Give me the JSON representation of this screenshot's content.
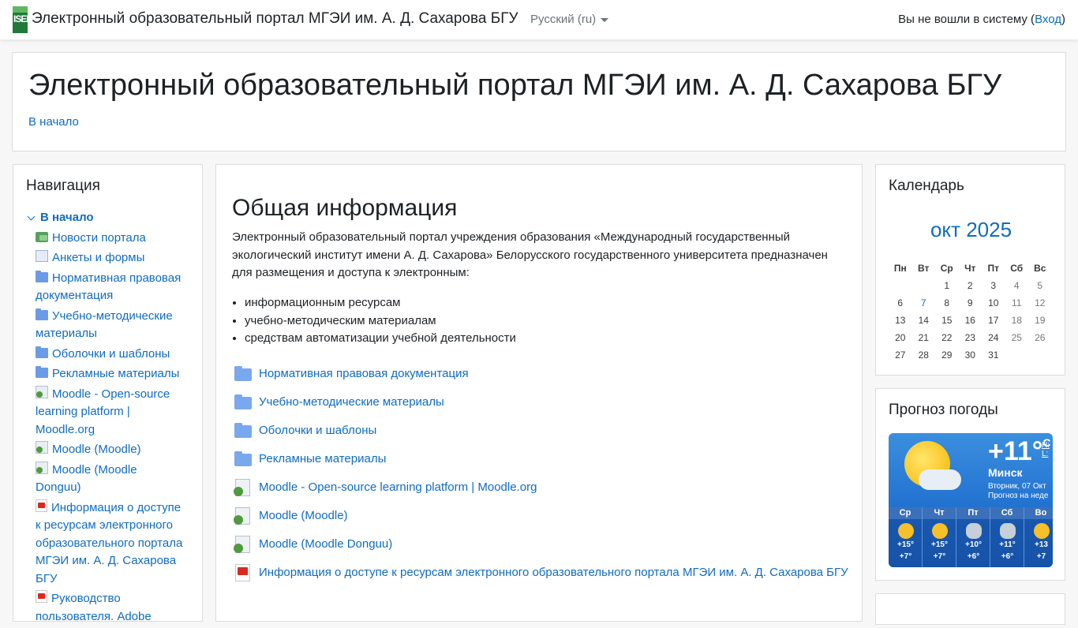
{
  "navbar": {
    "logo_text": "ISEI",
    "site_name": "Электронный образовательный портал МГЭИ им. А. Д. Сахарова БГУ",
    "language": "Русский (ru)",
    "login_prefix": "Вы не вошли в систему (",
    "login_link": "Вход",
    "login_suffix": ")"
  },
  "header": {
    "title": "Электронный образовательный портал МГЭИ им. А. Д. Сахарова БГУ",
    "breadcrumb": "В начало"
  },
  "navigation": {
    "title": "Навигация",
    "root": "В начало",
    "items": [
      {
        "label": "Новости портала",
        "icon": "forum-icon"
      },
      {
        "label": "Анкеты и формы",
        "icon": "feedback-icon"
      },
      {
        "label": "Нормативная правовая документация",
        "icon": "folder-icon"
      },
      {
        "label": "Учебно-методические материалы",
        "icon": "folder-icon"
      },
      {
        "label": "Оболочки и шаблоны",
        "icon": "folder-icon"
      },
      {
        "label": "Рекламные материалы",
        "icon": "folder-icon"
      },
      {
        "label": "Moodle - Open-source learning platform | Moodle.org",
        "icon": "url-icon"
      },
      {
        "label": "Moodle (Moodle)",
        "icon": "url-icon"
      },
      {
        "label": "Moodle (Moodle Donguu)",
        "icon": "url-icon"
      },
      {
        "label": "Информация о доступе к ресурсам электронного образовательного портала МГЭИ им. А. Д. Сахарова БГУ",
        "icon": "pdf-icon"
      },
      {
        "label": "Руководство пользователя. Adobe",
        "icon": "pdf-icon"
      }
    ]
  },
  "main": {
    "heading": "Общая информация",
    "intro": "Электронный образовательный портал учреждения образования «Международный государственный экологический институт имени А. Д. Сахарова» Белорусского государственного университета предназначен для размещения и доступа к электронным:",
    "bullets": [
      "информационным ресурсам",
      "учебно-методическим материалам",
      "средствам автоматизации учебной деятельности"
    ],
    "resources": [
      {
        "label": "Нормативная правовая документация",
        "icon": "folder-icon"
      },
      {
        "label": "Учебно-методические материалы",
        "icon": "folder-icon"
      },
      {
        "label": "Оболочки и шаблоны",
        "icon": "folder-icon"
      },
      {
        "label": "Рекламные материалы",
        "icon": "folder-icon"
      },
      {
        "label": "Moodle - Open-source learning platform | Moodle.org",
        "icon": "url-icon"
      },
      {
        "label": "Moodle (Moodle)",
        "icon": "url-icon"
      },
      {
        "label": "Moodle (Moodle Donguu)",
        "icon": "url-icon"
      },
      {
        "label": "Информация о доступе к ресурсам электронного образовательного портала МГЭИ им. А. Д. Сахарова БГУ",
        "icon": "pdf-icon"
      }
    ]
  },
  "calendar": {
    "title": "Календарь",
    "month": "окт 2025",
    "weekdays": [
      "Пн",
      "Вт",
      "Ср",
      "Чт",
      "Пт",
      "Сб",
      "Вс"
    ],
    "weeks": [
      [
        "",
        "",
        "1",
        "2",
        "3",
        "4",
        "5"
      ],
      [
        "6",
        "7",
        "8",
        "9",
        "10",
        "11",
        "12"
      ],
      [
        "13",
        "14",
        "15",
        "16",
        "17",
        "18",
        "19"
      ],
      [
        "20",
        "21",
        "22",
        "23",
        "24",
        "25",
        "26"
      ],
      [
        "27",
        "28",
        "29",
        "30",
        "31",
        "",
        ""
      ]
    ],
    "today": "7"
  },
  "weather": {
    "title": "Прогноз погоды",
    "temp": "+11°",
    "unit": "C",
    "hl": "Н:",
    "ll": "L:",
    "city": "Минск",
    "date": "Вторник, 07 Окт",
    "note": "Прогноз на неде",
    "days": [
      {
        "name": "Ср",
        "hi": "+15°",
        "lo": "+7°",
        "icon": "sun-cloud-icon"
      },
      {
        "name": "Чт",
        "hi": "+15°",
        "lo": "+7°",
        "icon": "sun-icon"
      },
      {
        "name": "Пт",
        "hi": "+10°",
        "lo": "+6°",
        "icon": "rain-icon"
      },
      {
        "name": "Сб",
        "hi": "+11°",
        "lo": "+6°",
        "icon": "rain-icon"
      },
      {
        "name": "Во",
        "hi": "+13",
        "lo": "+7",
        "icon": "sun-cloud-icon"
      }
    ]
  }
}
